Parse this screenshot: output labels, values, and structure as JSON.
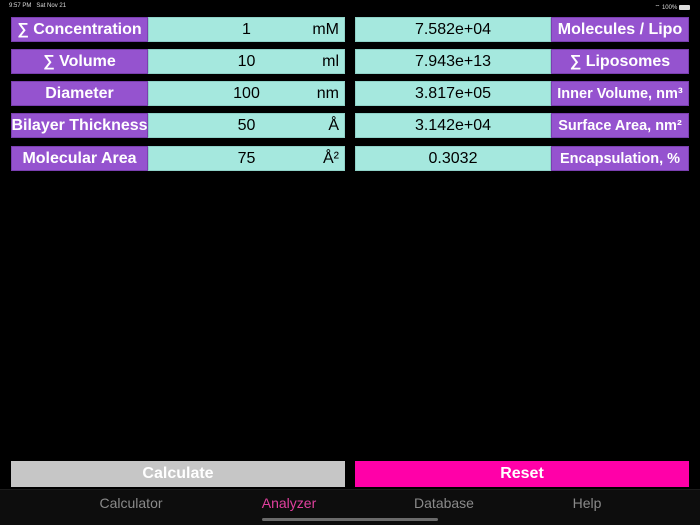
{
  "status": {
    "time": "9:57 PM",
    "date": "Sat Nov 21",
    "battery": "100%"
  },
  "inputs": [
    {
      "label": "∑ Concentration",
      "value": "1",
      "unit": "mM"
    },
    {
      "label": "∑ Volume",
      "value": "10",
      "unit": "ml"
    },
    {
      "label": "Diameter",
      "value": "100",
      "unit": "nm"
    },
    {
      "label": "Bilayer Thickness",
      "value": "50",
      "unit": "Å"
    },
    {
      "label": "Molecular Area",
      "value": "75",
      "unit": "Å²"
    }
  ],
  "outputs": [
    {
      "label": "Molecules / Lipo",
      "value": "7.582e+04"
    },
    {
      "label": "∑ Liposomes",
      "value": "7.943e+13"
    },
    {
      "label": "Inner Volume, nm³",
      "value": "3.817e+05"
    },
    {
      "label": "Surface Area, nm²",
      "value": "3.142e+04"
    },
    {
      "label": "Encapsulation, %",
      "value": "0.3032"
    }
  ],
  "buttons": {
    "calculate": "Calculate",
    "reset": "Reset"
  },
  "tabs": [
    "Calculator",
    "Analyzer",
    "Database",
    "Help"
  ],
  "colors": {
    "label": "#9553cf",
    "field": "#a5e8de",
    "accent": "#ff00a8",
    "active_tab": "#e0409e"
  }
}
